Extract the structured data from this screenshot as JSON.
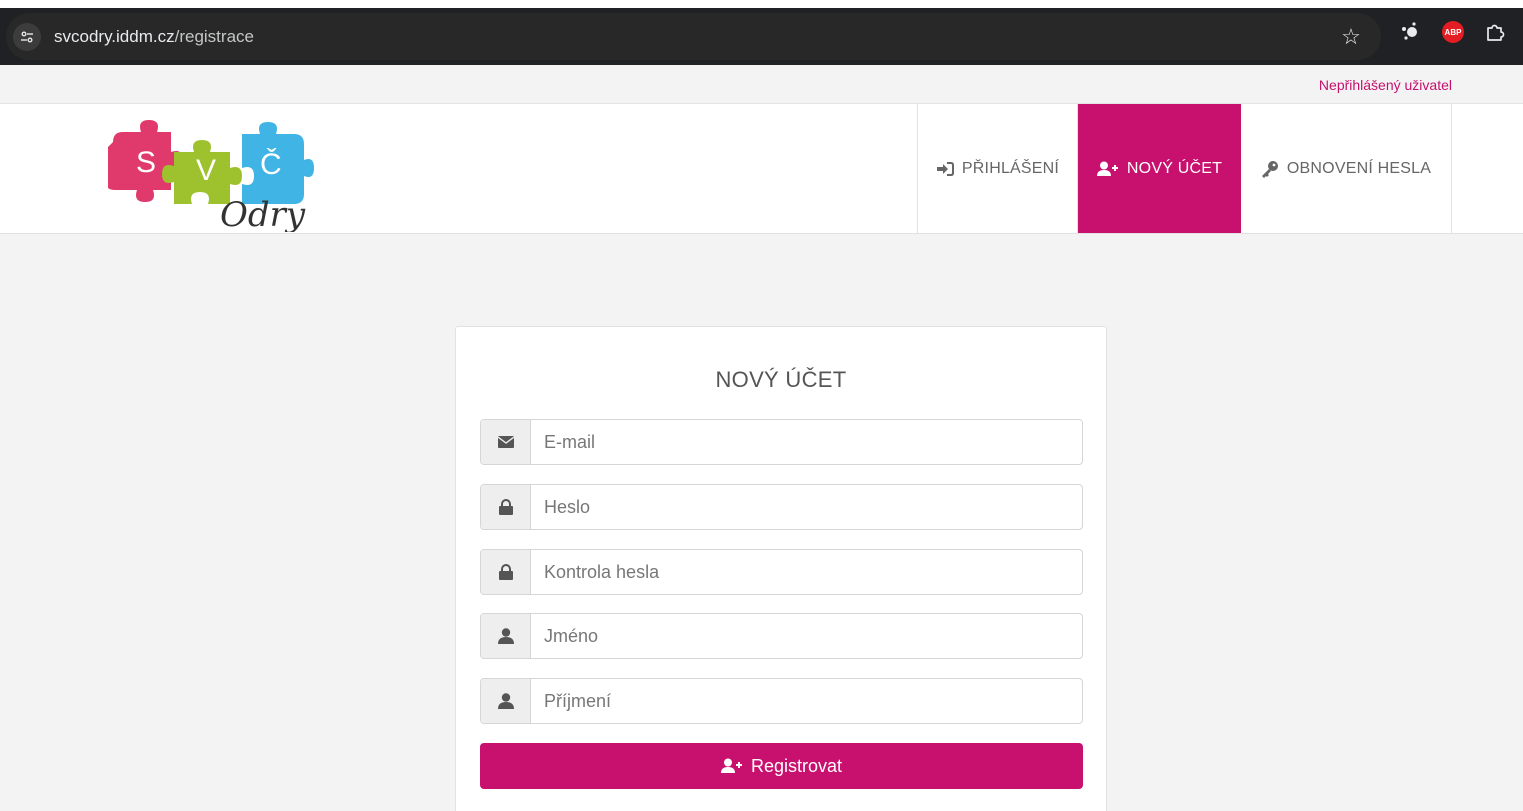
{
  "browser": {
    "url_host": "svcodry.iddm.cz",
    "url_path": "/registrace",
    "icons": [
      "site-info-icon",
      "bookmark-star-icon",
      "extension-connect-icon",
      "adblock-plus-icon",
      "extensions-puzzle-icon"
    ],
    "abp_label": "ABP"
  },
  "user_status": "Nepřihlášený uživatel",
  "logo": {
    "letters": [
      "S",
      "V",
      "Č"
    ],
    "script": "Odry",
    "colors": {
      "pink": "#e0396b",
      "green": "#9ec12e",
      "blue": "#3fb4e5"
    }
  },
  "nav": {
    "login_label": "PŘIHLÁŠENÍ",
    "new_account_label": "NOVÝ ÚČET",
    "reset_password_label": "OBNOVENÍ HESLA"
  },
  "form": {
    "title": "NOVÝ ÚČET",
    "fields": [
      {
        "placeholder": "E-mail",
        "icon": "envelope-icon"
      },
      {
        "placeholder": "Heslo",
        "icon": "lock-icon"
      },
      {
        "placeholder": "Kontrola hesla",
        "icon": "lock-icon"
      },
      {
        "placeholder": "Jméno",
        "icon": "user-icon"
      },
      {
        "placeholder": "Příjmení",
        "icon": "user-icon"
      }
    ],
    "submit_label": "Registrovat"
  },
  "colors": {
    "accent": "#c8106e",
    "browser_bar": "#202124"
  }
}
